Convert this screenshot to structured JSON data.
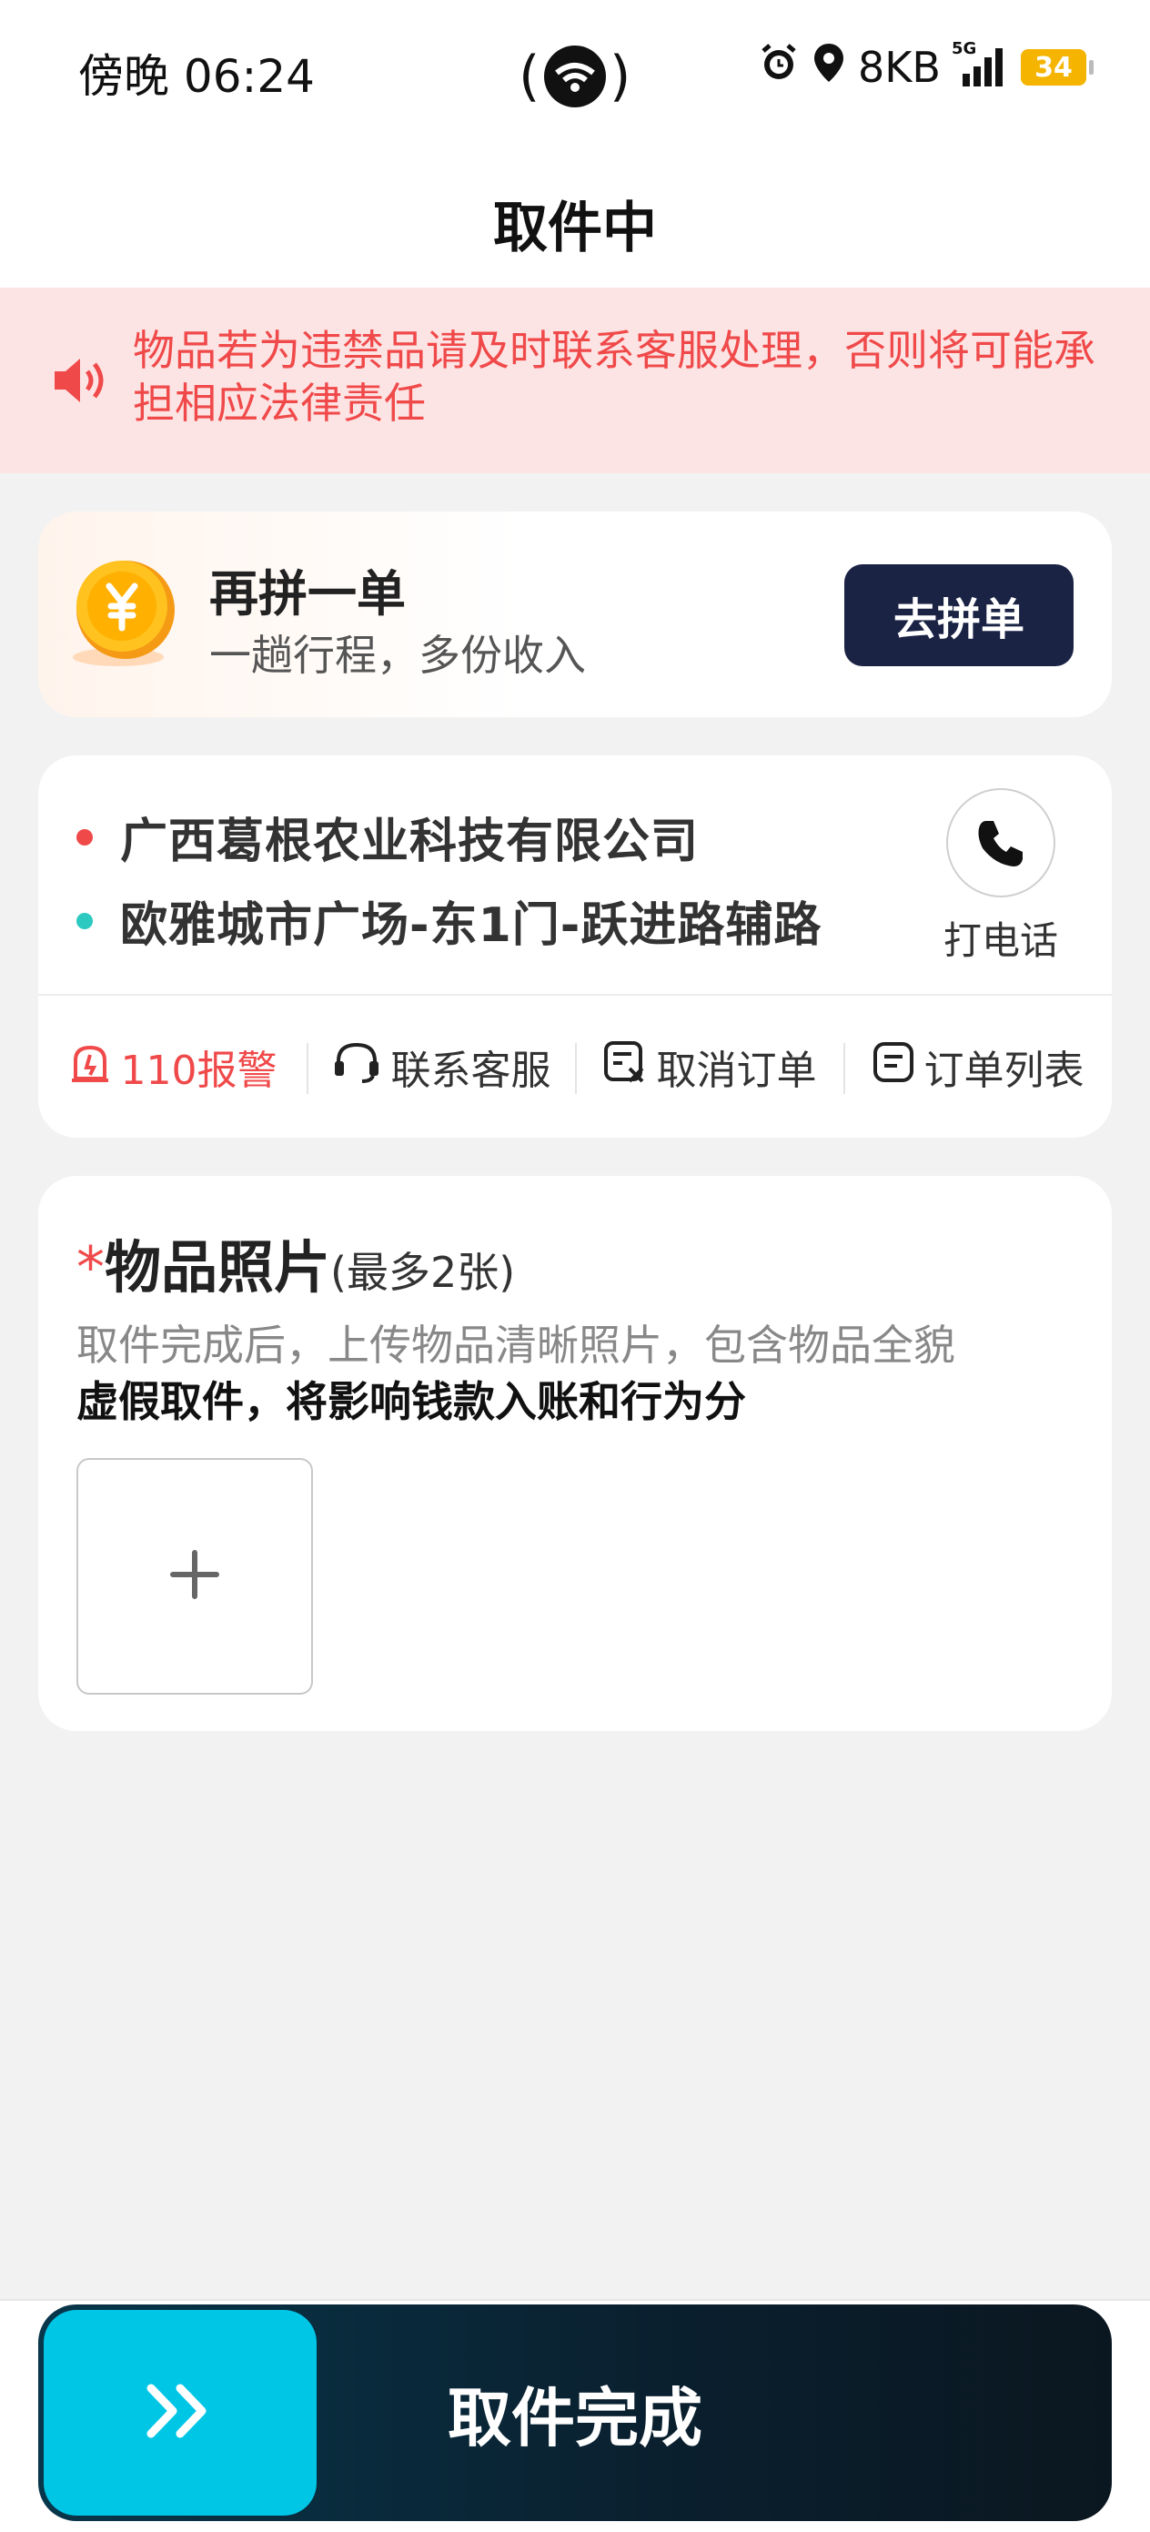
{
  "status_bar": {
    "time": "傍晚 06:24",
    "net_speed": "8KB",
    "network_type": "5G",
    "battery": "34",
    "icons": [
      "alarm-icon",
      "location-icon",
      "signal-icon",
      "battery-icon"
    ]
  },
  "nav": {
    "title": "取件中"
  },
  "notice": {
    "text": "物品若为违禁品请及时联系客服处理，否则将可能承担相应法律责任",
    "color": "#f0494a",
    "icon": "speaker-icon"
  },
  "combine": {
    "title": "再拼一单",
    "subtitle": "一趟行程，多份收入",
    "button_label": "去拼单",
    "icon": "coin-yuan-icon"
  },
  "address": {
    "pickup": "广西葛根农业科技有限公司",
    "dropoff": "欧雅城市广场-东1门-跃进路辅路",
    "pickup_dot_color": "#f0494a",
    "dropoff_dot_color": "#2cc9c0",
    "call_label": "打电话",
    "actions": [
      {
        "label": "110报警",
        "icon": "alarm-police-icon"
      },
      {
        "label": "联系客服",
        "icon": "headset-icon"
      },
      {
        "label": "取消订单",
        "icon": "cancel-order-icon"
      },
      {
        "label": "订单列表",
        "icon": "order-list-icon"
      }
    ]
  },
  "photo": {
    "required_mark": "*",
    "title": "物品照片",
    "limit": "(最多2张)",
    "desc": "取件完成后，上传物品清晰照片，包含物品全貌",
    "warning": "虚假取件，将影响钱款入账和行为分",
    "upload_icon": "plus-icon"
  },
  "slider": {
    "label": "取件完成",
    "handle_color": "#00c6e6"
  }
}
